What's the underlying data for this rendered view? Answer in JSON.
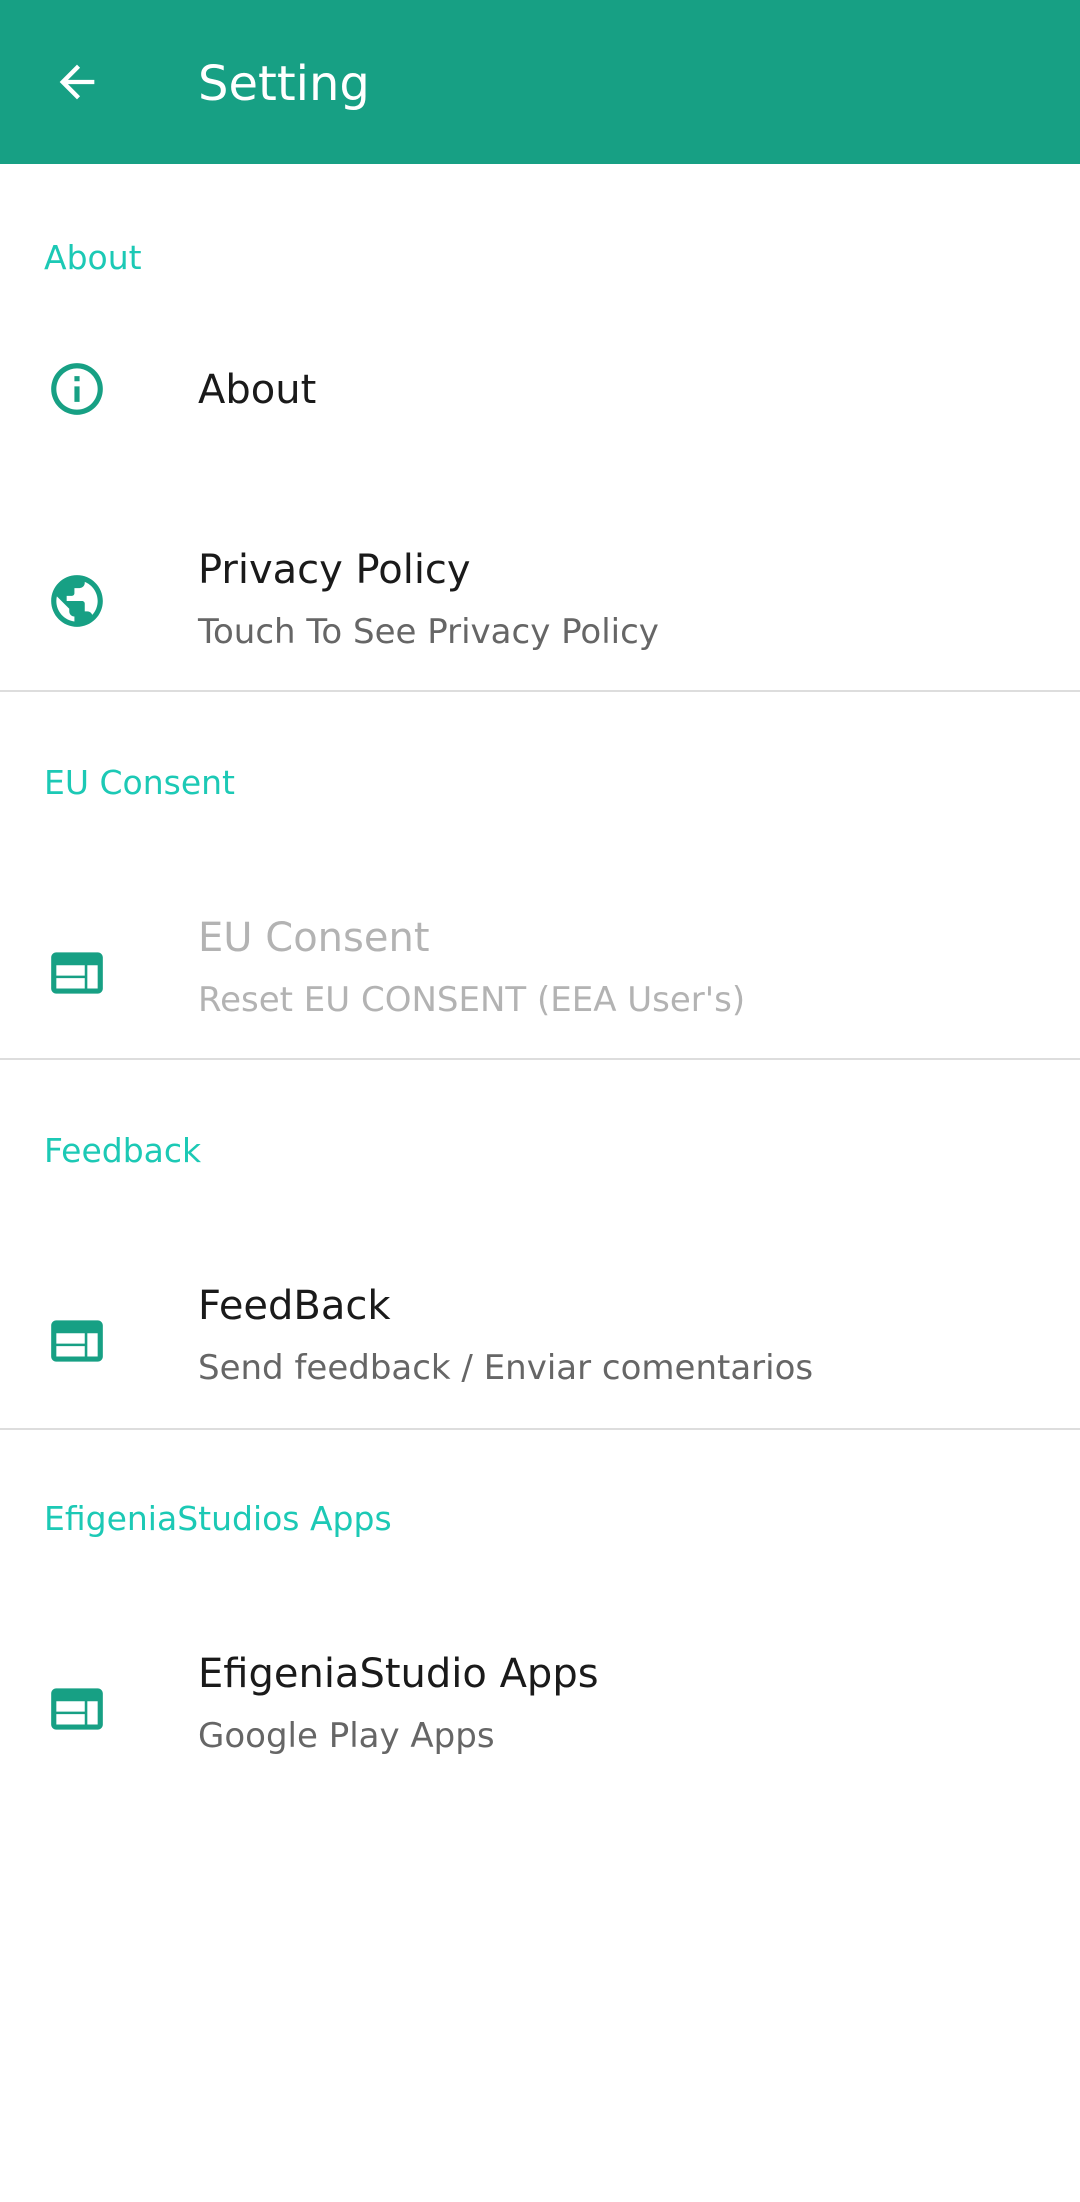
{
  "appbar": {
    "title": "Setting",
    "back_icon": "arrow-left-icon",
    "background": "#17a084"
  },
  "accent_color": "#1cc9b5",
  "sections": [
    {
      "header": "About",
      "items": [
        {
          "title": "About",
          "summary": "",
          "icon": "info-icon"
        },
        {
          "title": "Privacy Policy",
          "summary": "Touch To See Privacy Policy",
          "icon": "globe-icon"
        }
      ]
    },
    {
      "header": "EU Consent",
      "items": [
        {
          "title": "EU Consent",
          "summary": "Reset EU CONSENT (EEA User's)",
          "icon": "web-layout-icon",
          "enabled": false
        }
      ]
    },
    {
      "header": "Feedback",
      "items": [
        {
          "title": "FeedBack",
          "summary": "Send feedback / Enviar comentarios",
          "icon": "web-layout-icon"
        }
      ]
    },
    {
      "header": "EfigeniaStudios Apps",
      "items": [
        {
          "title": "EfigeniaStudio Apps",
          "summary": "Google Play Apps",
          "icon": "web-layout-icon"
        }
      ]
    }
  ]
}
